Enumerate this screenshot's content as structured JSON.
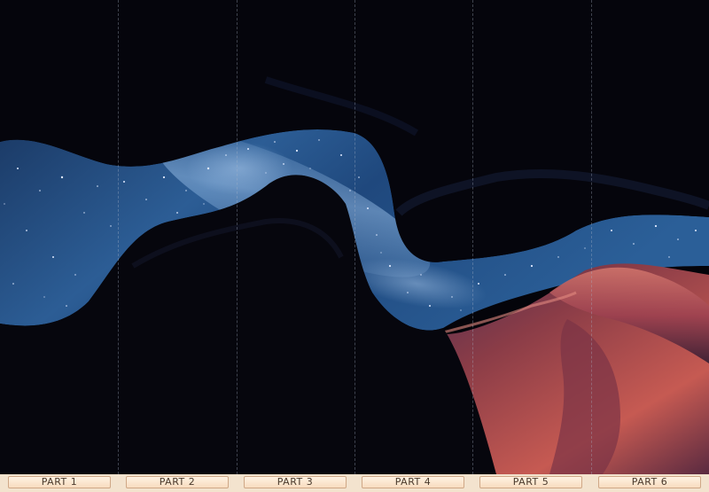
{
  "image": {
    "subject": "night-sky-through-slot-canyon-icon",
    "colors": {
      "sky_deep": "#0b1d3c",
      "sky_mid": "#2a5a93",
      "milky_way": "#6f9fd0",
      "rock_dark": "#05050b",
      "rock_red": "#b14a3f",
      "rock_highlight": "#d8736a"
    }
  },
  "parts": [
    {
      "label": "PART 1"
    },
    {
      "label": "PART 2"
    },
    {
      "label": "PART 3"
    },
    {
      "label": "PART 4"
    },
    {
      "label": "PART 5"
    },
    {
      "label": "PART 6"
    }
  ],
  "panel_count": 6,
  "colors": {
    "bar_background": "#f3e3ce",
    "label_fill": "#fbe6cf",
    "label_border": "#cfa887",
    "label_text": "#4a3a2c"
  }
}
